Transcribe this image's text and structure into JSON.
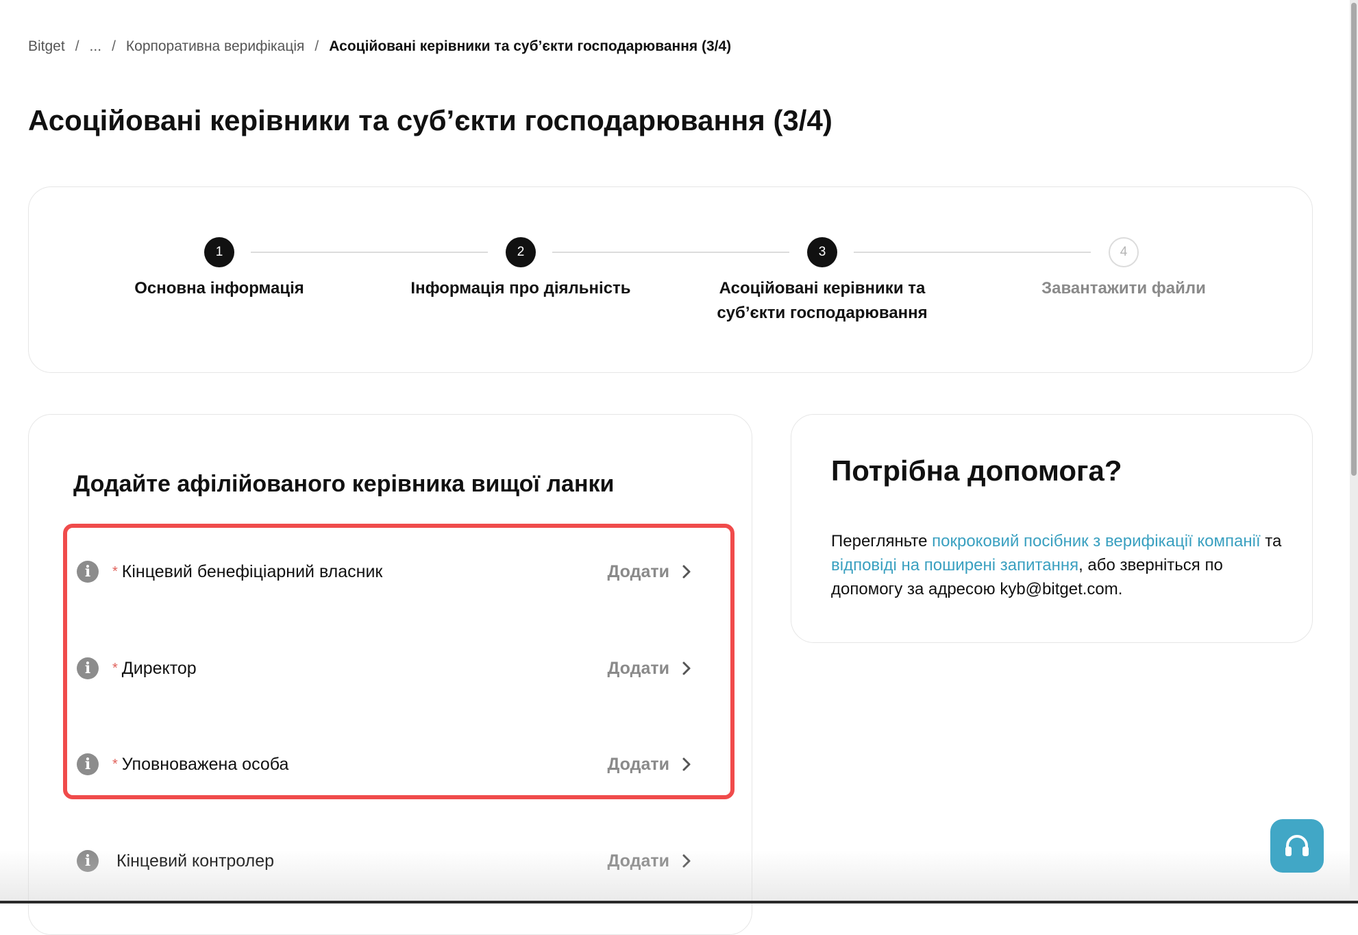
{
  "breadcrumb": {
    "items": [
      "Bitget",
      "...",
      "Корпоративна верифікація"
    ],
    "separator": "/",
    "current": "Асоційовані керівники та суб’єкти господарювання (3/4)"
  },
  "page_title": "Асоційовані керівники та суб’єкти господарювання (3/4)",
  "stepper": {
    "steps": [
      {
        "number": "1",
        "label_lines": [
          "Основна інформація"
        ],
        "state": "completed"
      },
      {
        "number": "2",
        "label_lines": [
          "Інформація про діяльність"
        ],
        "state": "completed"
      },
      {
        "number": "3",
        "label_lines": [
          "Асоційовані керівники та",
          "суб’єкти господарювання"
        ],
        "state": "current"
      },
      {
        "number": "4",
        "label_lines": [
          "Завантажити файли"
        ],
        "state": "pending"
      }
    ]
  },
  "officers": {
    "title": "Додайте афілійованого керівника вищої ланки",
    "required_marker": "*",
    "roles": [
      {
        "label": "Кінцевий бенефіціарний власник",
        "required": true,
        "action": "Додати"
      },
      {
        "label": "Директор",
        "required": true,
        "action": "Додати"
      },
      {
        "label": "Уповноважена особа",
        "required": true,
        "action": "Додати"
      },
      {
        "label": "Кінцевий контролер",
        "required": false,
        "action": "Додати"
      }
    ]
  },
  "help": {
    "title": "Потрібна допомога?",
    "text_1": "Перегляньте ",
    "link_1": "покроковий посібник з верифікації компанії",
    "text_2": " та ",
    "link_2": "відповіді на поширені запитання",
    "text_3": ", або зверніться по допомогу за адресою kyb@bitget.com."
  },
  "icons": {
    "info": "info-icon",
    "chevron": "chevron-right-icon",
    "support": "headset-icon"
  },
  "colors": {
    "accent_link": "#3aa0c0",
    "highlight_border": "#f04b4b",
    "required_marker": "#e0605a",
    "step_active": "#111111",
    "support_button": "#41a7c6"
  }
}
